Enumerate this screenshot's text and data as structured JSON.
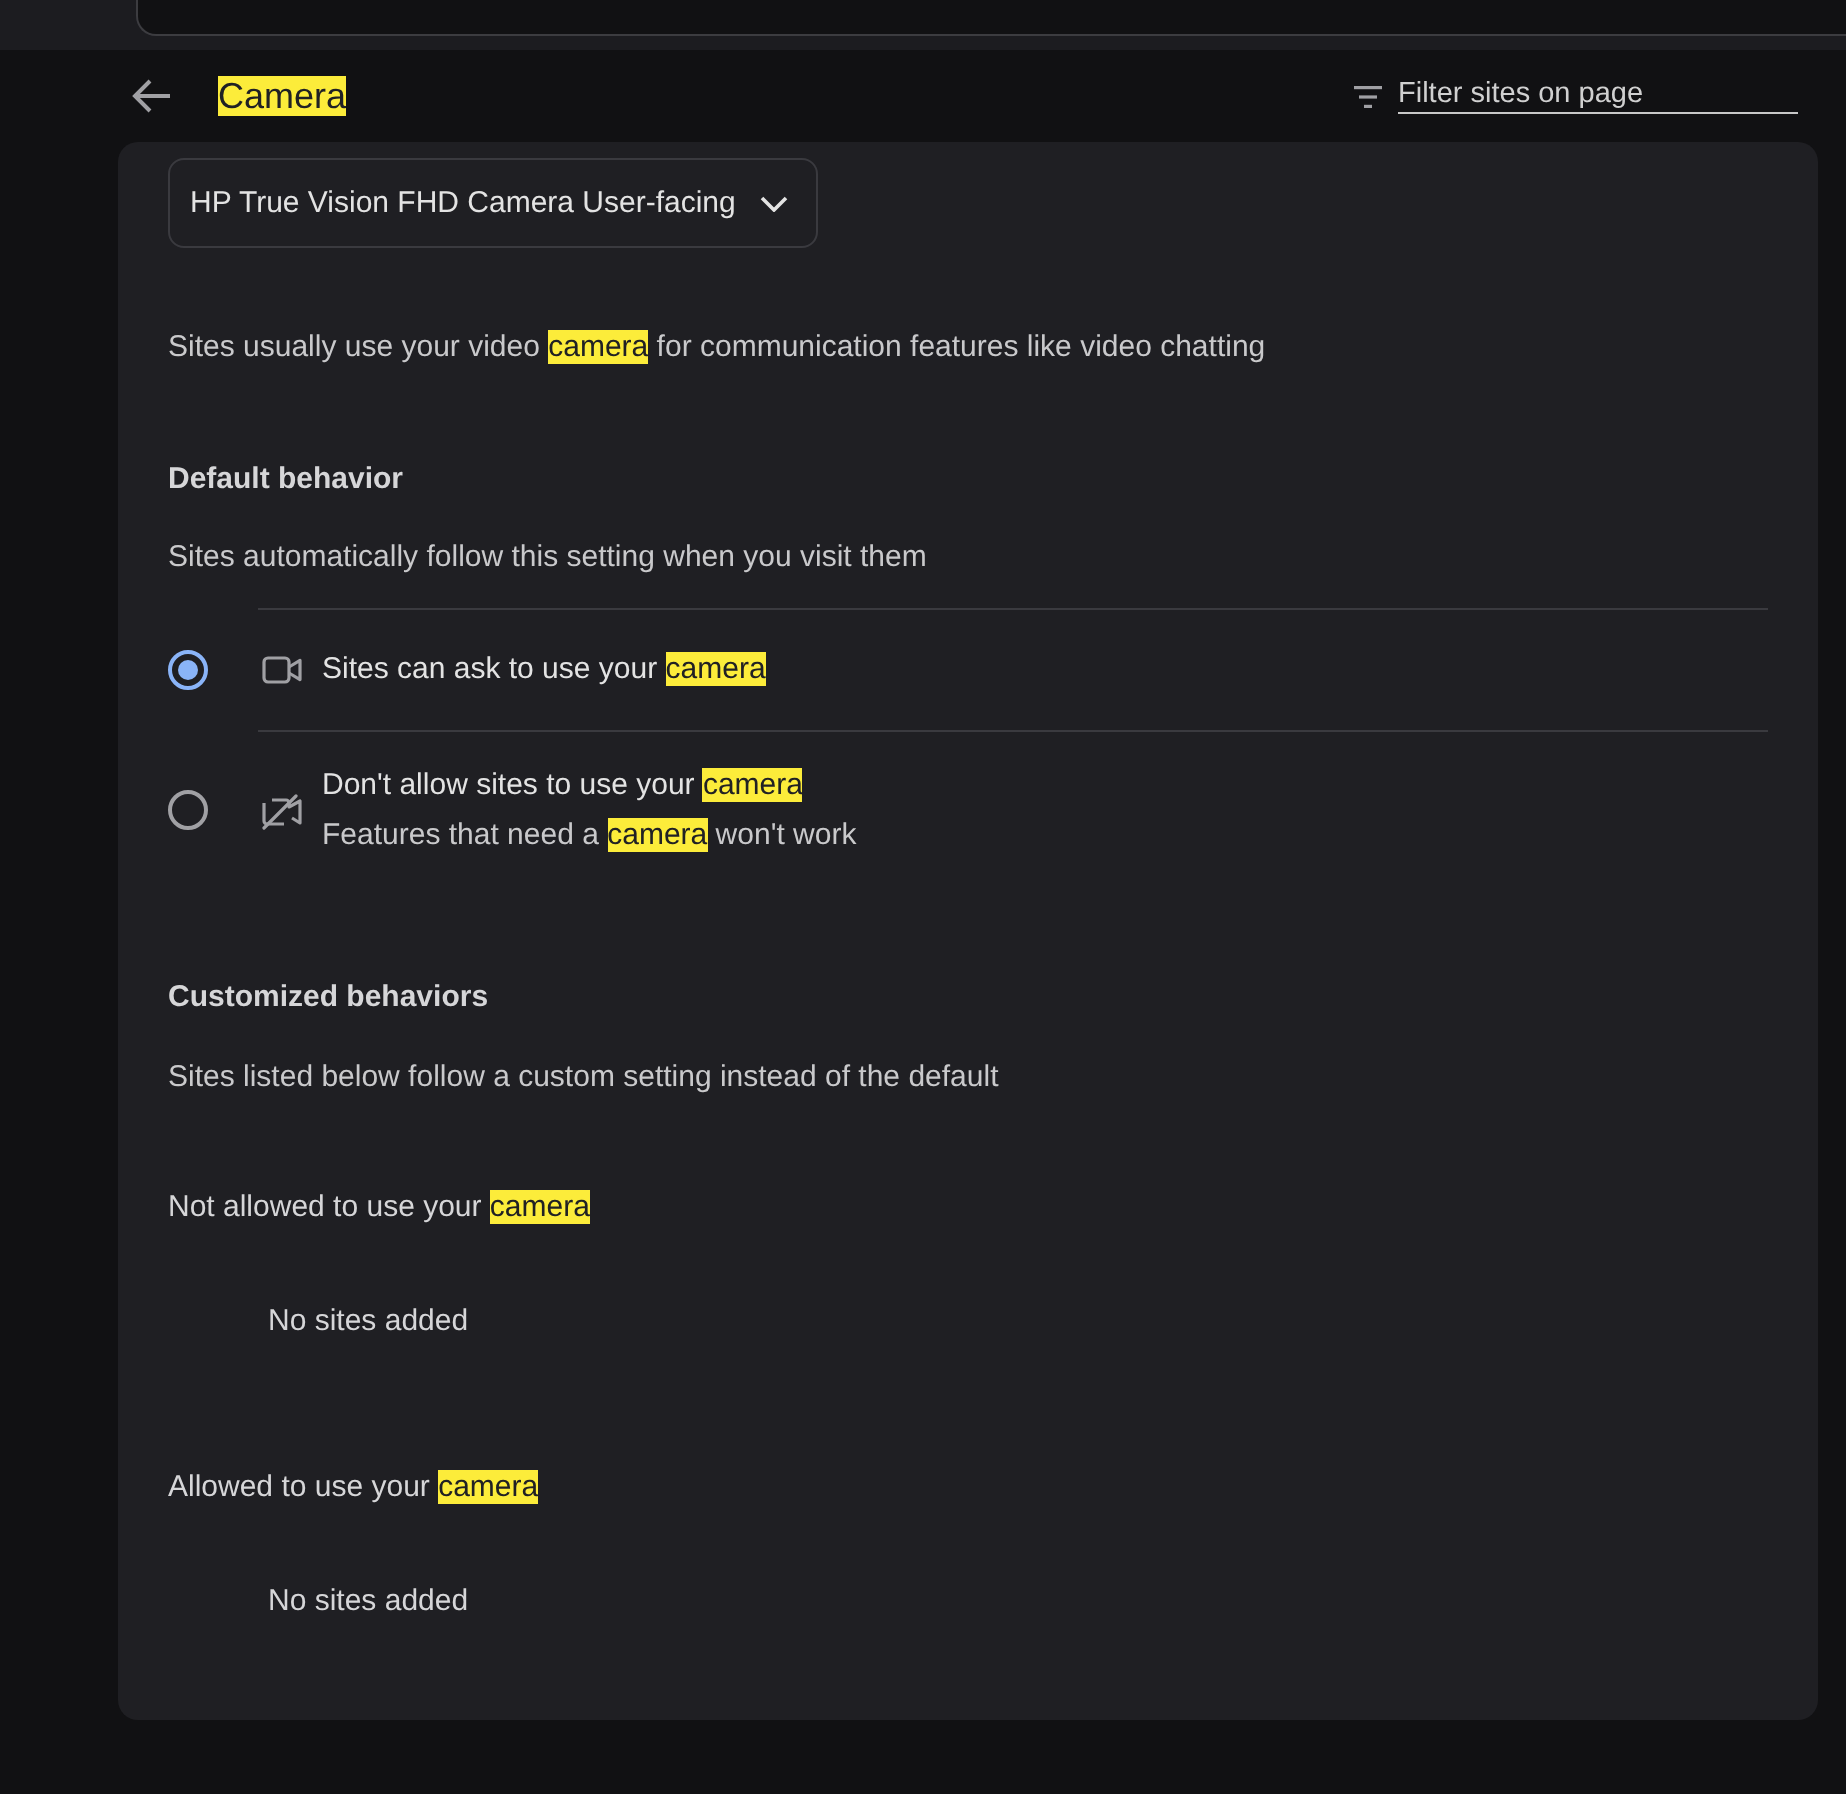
{
  "header": {
    "title": [
      {
        "text": "Camera",
        "highlighted": true
      }
    ],
    "filter": {
      "placeholder": "Filter sites on page"
    }
  },
  "device_select": {
    "value": "HP True Vision FHD Camera User-facing"
  },
  "description": [
    {
      "text": "Sites usually use your video ",
      "highlighted": false
    },
    {
      "text": "camera",
      "highlighted": true
    },
    {
      "text": " for communication features like video chatting",
      "highlighted": false
    }
  ],
  "default_behavior": {
    "heading": "Default behavior",
    "subtitle": "Sites automatically follow this setting when you visit them",
    "options": [
      {
        "kind": "ask",
        "selected": true,
        "label": [
          {
            "text": "Sites can ask to use your ",
            "highlighted": false
          },
          {
            "text": "camera",
            "highlighted": true
          }
        ]
      },
      {
        "kind": "block",
        "selected": false,
        "label": [
          {
            "text": "Don't allow sites to use your ",
            "highlighted": false
          },
          {
            "text": "camera",
            "highlighted": true
          }
        ],
        "sublabel": [
          {
            "text": "Features that need a ",
            "highlighted": false
          },
          {
            "text": "camera",
            "highlighted": true
          },
          {
            "text": " won't work",
            "highlighted": false
          }
        ]
      }
    ]
  },
  "customized_behaviors": {
    "heading": "Customized behaviors",
    "subtitle": "Sites listed below follow a custom setting instead of the default",
    "lists": [
      {
        "title": [
          {
            "text": "Not allowed to use your ",
            "highlighted": false
          },
          {
            "text": "camera",
            "highlighted": true
          }
        ],
        "empty_text": "No sites added"
      },
      {
        "title": [
          {
            "text": "Allowed to use your ",
            "highlighted": false
          },
          {
            "text": "camera",
            "highlighted": true
          }
        ],
        "empty_text": "No sites added"
      }
    ]
  }
}
